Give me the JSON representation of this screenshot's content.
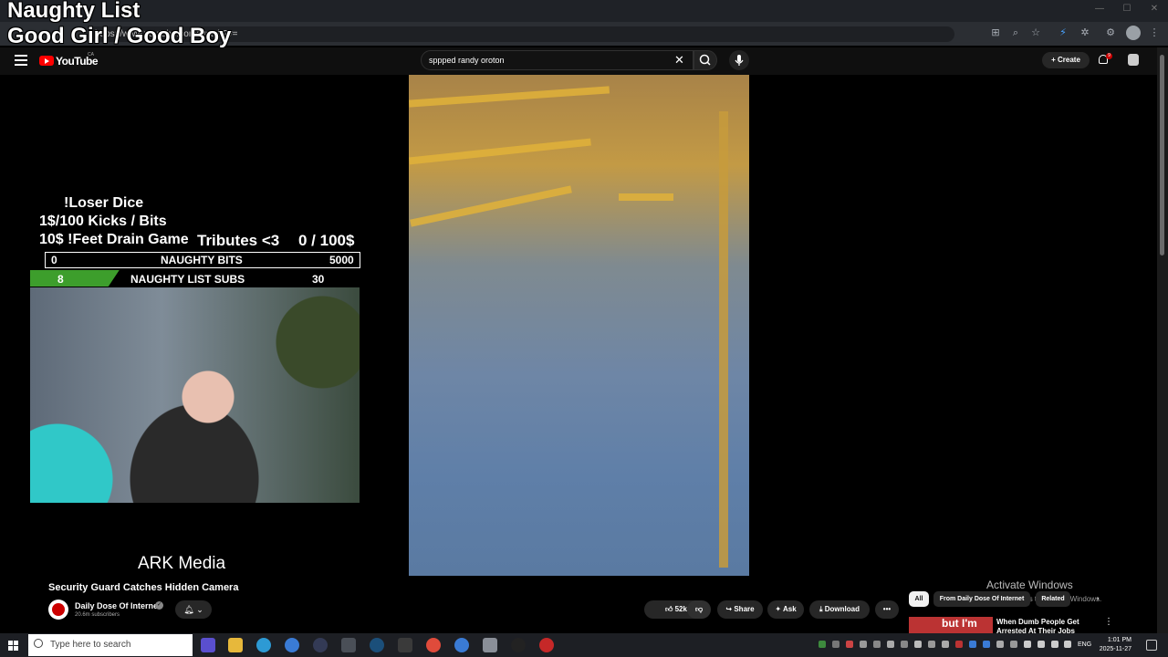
{
  "browser": {
    "address_text": "...wwwyou...ch...QmobEs",
    "address_prefix": "https://www.youtube.com/watch?v=",
    "tab_plus": "+"
  },
  "overlay": {
    "title_line1": "Naughty List",
    "title_line2": "Good Girl / Good Boy",
    "dice_line1": "!Loser Dice",
    "dice_line2": "1$/100 Kicks / Bits",
    "dice_line3": "10$ !Feet Drain Game",
    "tributes_label": "Tributes <3",
    "tributes_value": "0 / 100$",
    "bits_left": "0",
    "bits_label": "NAUGHTY BITS",
    "bits_right": "5000",
    "subs_left": "8",
    "subs_label": "NAUGHTY LIST SUBS",
    "subs_right": "30",
    "subs_progress_fraction": 0.27,
    "ark_label": "ARK Media"
  },
  "youtube": {
    "logo_text": "YouTube",
    "logo_region": "CA",
    "search_value": "sppped randy oroton",
    "create_label": "Create",
    "notification_count": "9",
    "video_title": "Security Guard Catches Hidden Camera",
    "channel_name": "Daily Dose Of Internet",
    "channel_verified": "✓",
    "channel_subs": "20.6m subscribers",
    "like_count": "52k",
    "share_label": "Share",
    "ask_label": "Ask",
    "download_label": "Download",
    "more_label": "•••",
    "chips": [
      "All",
      "From Daily Dose Of Internet",
      "Related"
    ],
    "related_title": "When Dumb People Get Arrested At Their Jobs",
    "related_thumb_text": "but I'm",
    "activate_title": "Activate Windows",
    "activate_sub": "Go to Settings to activate Windows."
  },
  "taskbar": {
    "search_placeholder": "Type here to search",
    "lang": "ENG",
    "time": "1:01 PM",
    "date": "2025-11-27"
  }
}
